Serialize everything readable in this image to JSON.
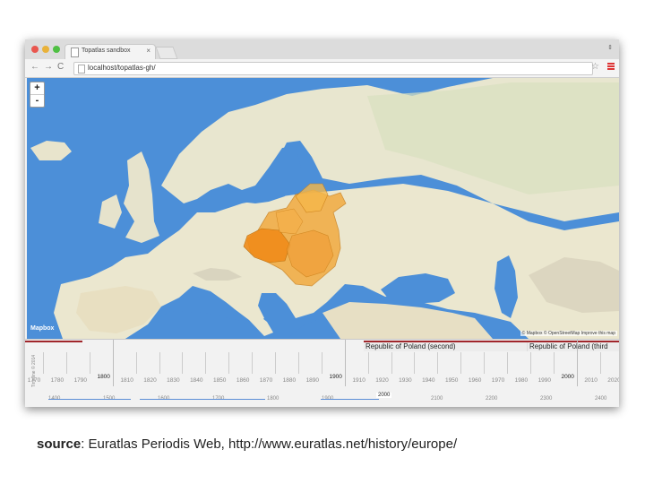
{
  "browser": {
    "tab_title": "Topatlas sandbox",
    "tab_close": "×",
    "url": "localhost/topatlas-gh/",
    "nav": {
      "back": "←",
      "forward": "→",
      "reload": "C"
    },
    "star": "☆",
    "window_button": "⇕"
  },
  "map": {
    "zoom_in": "+",
    "zoom_out": "-",
    "logo": "Mapbox",
    "attribution": "© Mapbox © OpenStreetMap Improve this map",
    "colors": {
      "sea": "#4c8fd8",
      "land": "#eae6cf",
      "highlight": "#f08c1a"
    }
  },
  "timeline": {
    "vertical_label": "Timeline © 2014",
    "periods": [
      {
        "label": "Republic of Poland (second)"
      },
      {
        "label": "Republic of Poland (third"
      }
    ],
    "upper_years": [
      "1770",
      "1780",
      "1790",
      "1800",
      "1810",
      "1820",
      "1830",
      "1840",
      "1850",
      "1860",
      "1870",
      "1880",
      "1890",
      "1900",
      "1910",
      "1920",
      "1930",
      "1940",
      "1950",
      "1960",
      "1970",
      "1980",
      "1990",
      "2000",
      "2010",
      "2020"
    ],
    "highlighted_upper": [
      "1800",
      "1900",
      "2000"
    ],
    "lower_years": [
      "1400",
      "1500",
      "1600",
      "1700",
      "1800",
      "1900",
      "2000",
      "2100",
      "2200",
      "2300",
      "2400"
    ],
    "highlighted_lower": "2000"
  },
  "caption": {
    "label": "source",
    "text": ": Euratlas Periodis Web, http://www.euratlas.net/history/europe/"
  }
}
